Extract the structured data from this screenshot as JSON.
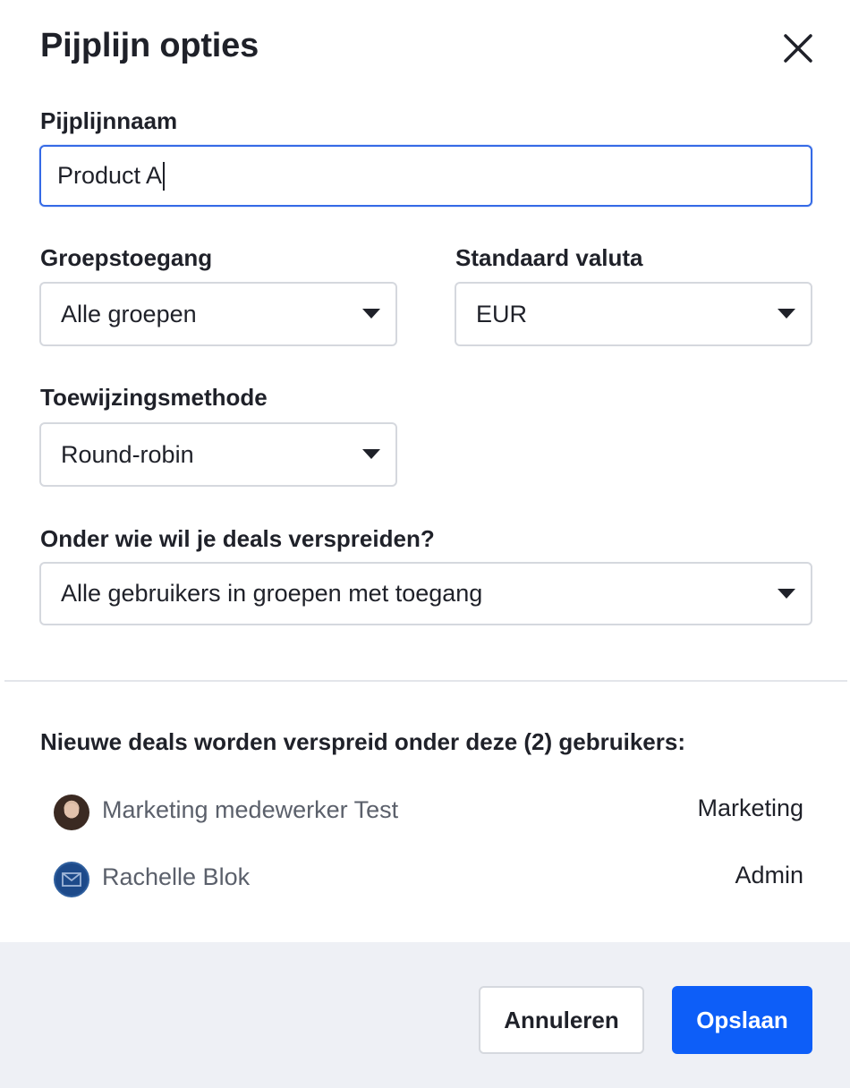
{
  "dialog": {
    "title": "Pijplijn opties",
    "close_icon": "close-icon"
  },
  "fields": {
    "pipeline_name": {
      "label": "Pijplijnnaam",
      "value": "Product A"
    },
    "group_access": {
      "label": "Groepstoegang",
      "selected": "Alle groepen"
    },
    "default_currency": {
      "label": "Standaard valuta",
      "selected": "EUR"
    },
    "assignment_method": {
      "label": "Toewijzingsmethode",
      "selected": "Round-robin"
    },
    "distribute_among": {
      "label": "Onder wie wil je deals verspreiden?",
      "selected": "Alle gebruikers in groepen met toegang"
    }
  },
  "users": {
    "heading": "Nieuwe deals worden verspreid onder deze (2) gebruikers:",
    "list": [
      {
        "name": "Marketing medewerker Test",
        "role": "Marketing",
        "avatar": "photo-avatar"
      },
      {
        "name": "Rachelle Blok",
        "role": "Admin",
        "avatar": "mail-avatar-icon"
      }
    ]
  },
  "footer": {
    "cancel_label": "Annuleren",
    "save_label": "Opslaan"
  },
  "colors": {
    "primary": "#0d5ef8",
    "focus_border": "#356ae6",
    "footer_bg": "#eef0f5"
  }
}
